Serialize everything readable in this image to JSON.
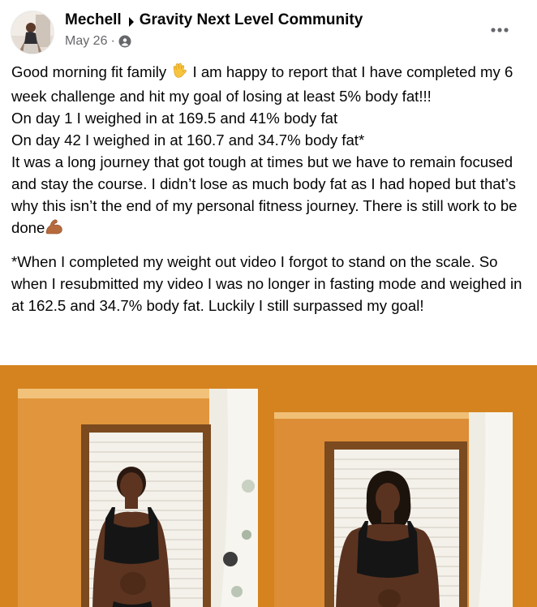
{
  "post": {
    "author_name": "Mechell",
    "group_name": "Gravity Next Level Community",
    "date": "May 26",
    "separator": "·",
    "audience_icon": "globe-icon",
    "more_icon": "more-options-icon",
    "text": {
      "line1_before_emoji": "Good morning fit family ",
      "line1_emoji": "waving-hand-icon",
      "line1_after_emoji": " I am happy to report that I have completed my 6 week challenge and hit my goal of losing at least 5% body fat!!!",
      "line2": "On day 1 I weighed in at 169.5 and 41% body fat",
      "line3": "On day 42 I weighed in at 160.7 and 34.7% body fat*",
      "line4_before_emoji": "It was a long journey that got tough at times but we have to remain focused and stay the course. I didn’t lose as much body fat as I had hoped but that’s why this isn’t the end of my personal fitness journey. There is still work to be done",
      "line4_emoji": "flexed-biceps-icon",
      "footnote": "*When I completed my weight out video I forgot to stand on the scale. So when I resubmitted my video I was no longer in fasting mode and weighed in at 162.5 and 34.7% body fat. Luckily I still surpassed my goal!"
    },
    "colors": {
      "photo_background": "#d5831f",
      "secondary_text": "#65676b"
    }
  }
}
